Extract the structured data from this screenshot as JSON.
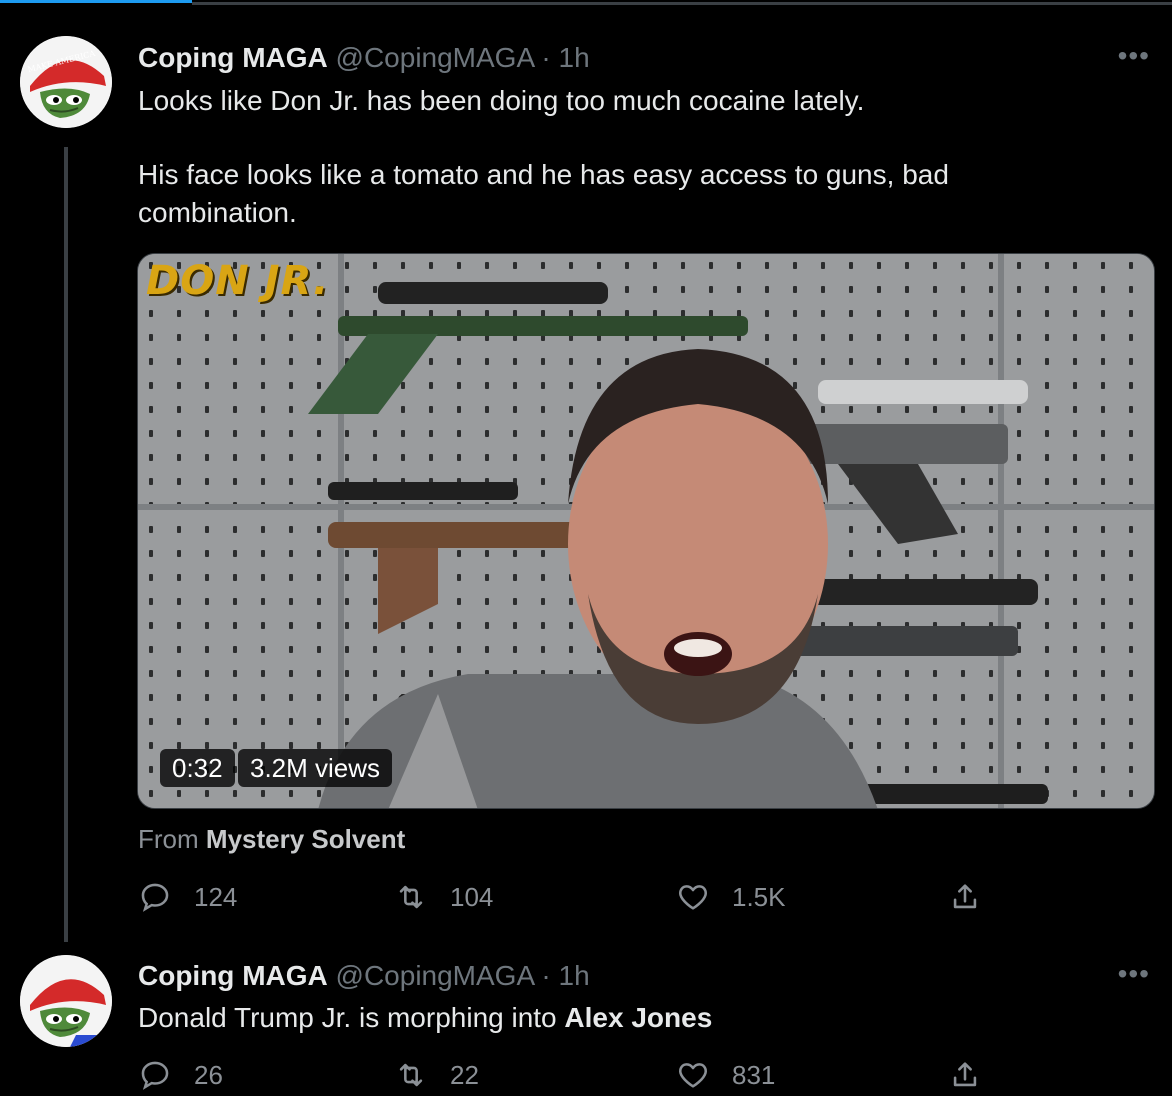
{
  "tweets": [
    {
      "display_name": "Coping MAGA",
      "handle": "@CopingMAGA",
      "separator": "·",
      "time": "1h",
      "more": "•••",
      "text_line1": "Looks like Don Jr. has been doing too much cocaine lately.",
      "text_line2": "His face looks like a tomato and he has easy access to guns, bad",
      "text_line3": "combination.",
      "media": {
        "overlay_title": "DON JR.",
        "duration": "0:32",
        "views": "3.2M views"
      },
      "from_prefix": "From",
      "from_name": "Mystery Solvent",
      "replies": "124",
      "retweets": "104",
      "likes": "1.5K"
    },
    {
      "display_name": "Coping MAGA",
      "handle": "@CopingMAGA",
      "separator": "·",
      "time": "1h",
      "more": "•••",
      "text_prefix": "Donald Trump Jr. is morphing into ",
      "text_bold": "Alex Jones",
      "replies": "26",
      "retweets": "22",
      "likes": "831"
    }
  ],
  "icons": [
    "reply-icon",
    "retweet-icon",
    "like-icon",
    "share-icon",
    "more-icon"
  ],
  "colors": {
    "accent": "#1d9bf0",
    "background": "#000000",
    "muted": "#6e767d",
    "text": "#e7e9ea"
  }
}
